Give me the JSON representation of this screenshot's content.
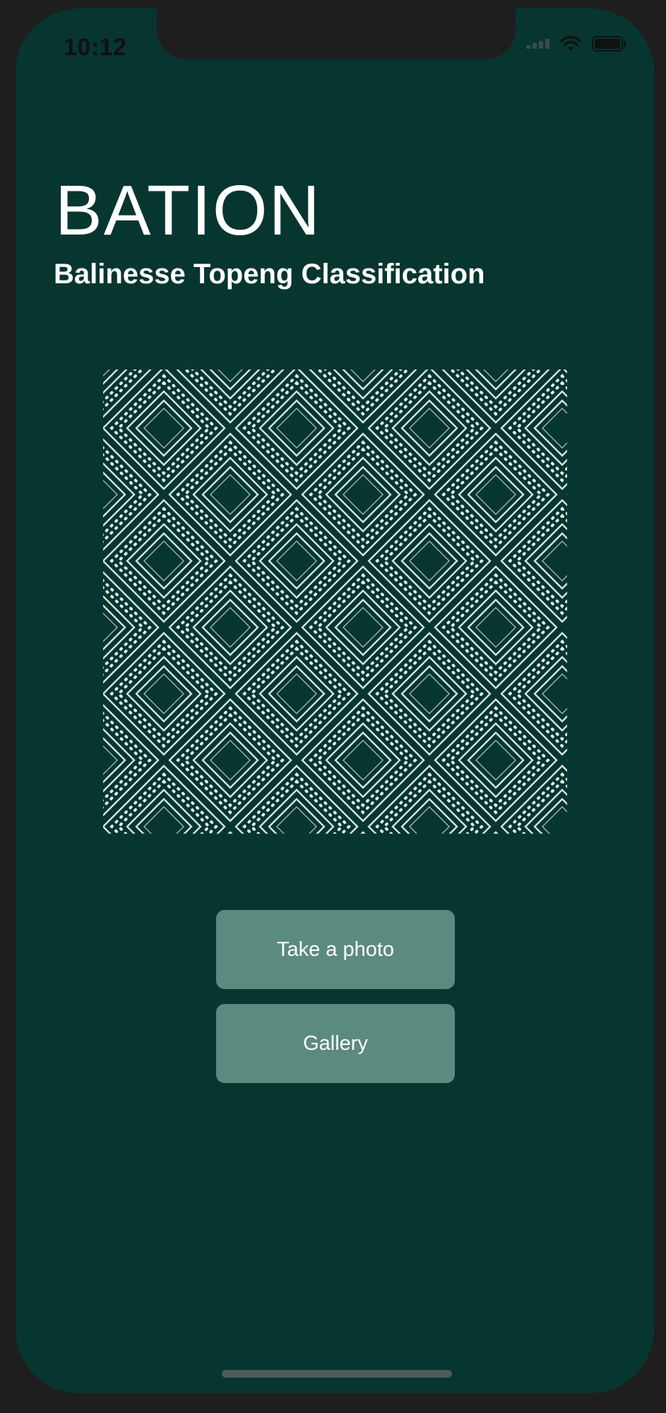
{
  "status_bar": {
    "time": "10:12",
    "icons": [
      "signal-icon",
      "wifi-icon",
      "battery-icon"
    ]
  },
  "header": {
    "title": "BATION",
    "subtitle": "Balinesse Topeng Classification"
  },
  "hero_image": {
    "description_icon": "diamond-pattern-image"
  },
  "actions": {
    "take_photo_label": "Take a photo",
    "gallery_label": "Gallery"
  },
  "colors": {
    "background": "#06362f",
    "button": "#5b8a7f",
    "text": "#ffffff"
  }
}
